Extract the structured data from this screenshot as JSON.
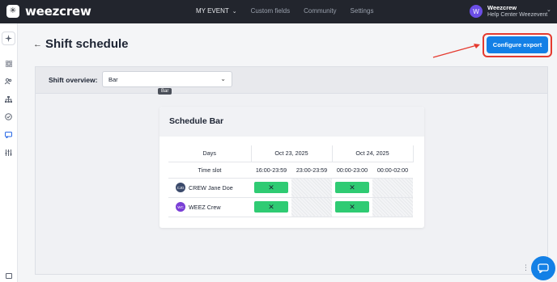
{
  "topbar": {
    "logo_glyph": "✳",
    "brand": "weezcrew",
    "nav": [
      {
        "label": "MY EVENT",
        "active": true,
        "dropdown": true
      },
      {
        "label": "Custom fields",
        "active": false
      },
      {
        "label": "Community",
        "active": false
      },
      {
        "label": "Settings",
        "active": false
      }
    ],
    "user": {
      "initial": "W",
      "name": "Weezcrew",
      "subtitle": "Help Center Weezevent"
    }
  },
  "sidebar": {
    "items": [
      "sparkle-icon",
      "grid-icon",
      "users-icon",
      "org-chart-icon",
      "check-circle-icon",
      "chat-icon",
      "sliders-icon"
    ],
    "active": "chat-icon"
  },
  "header": {
    "back_glyph": "←",
    "title": "Shift schedule",
    "export_button": "Configure export",
    "highlight_color": "#e53a2f"
  },
  "overview": {
    "label": "Shift overview:",
    "selected": "Bar",
    "tooltip": "Bar"
  },
  "card": {
    "title": "Schedule Bar",
    "days_label": "Days",
    "timeslot_label": "Time slot",
    "days": [
      "Oct 23, 2025",
      "Oct 24, 2025"
    ],
    "slots": [
      "16:00-23:59",
      "23:00-23:59",
      "00:00-23:00",
      "00:00-02:00"
    ],
    "members": [
      {
        "initials": "CJD",
        "name": "CREW Jane Doe",
        "color": "#3b4a6b",
        "shifts": [
          true,
          false,
          true,
          false
        ]
      },
      {
        "initials": "WC",
        "name": "WEEZ Crew",
        "color": "#7a3fd6",
        "shifts": [
          true,
          false,
          true,
          false
        ]
      }
    ],
    "shift_glyph": "✕",
    "shift_color": "#2fcb73"
  },
  "colors": {
    "accent": "#1380e6",
    "topbar": "#22252d"
  }
}
